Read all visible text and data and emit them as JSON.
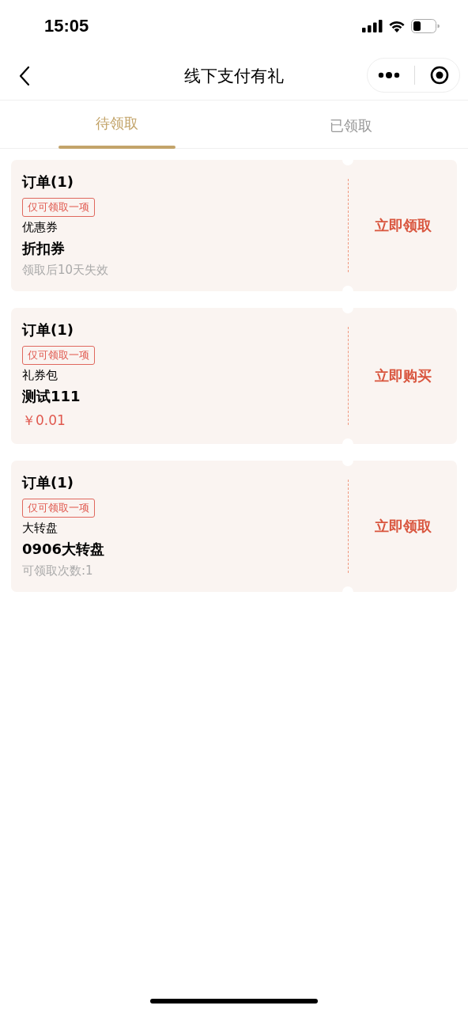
{
  "status_bar": {
    "time": "15:05"
  },
  "nav": {
    "title": "线下支付有礼"
  },
  "tabs": [
    {
      "label": "待领取",
      "selected": true
    },
    {
      "label": "已领取",
      "selected": false
    }
  ],
  "cards": [
    {
      "title": "订单(1)",
      "tag": "仅可领取一项",
      "category": "优惠券",
      "name": "折扣券",
      "footer": "领取后10天失效",
      "kind": "note",
      "action": "立即领取"
    },
    {
      "title": "订单(1)",
      "tag": "仅可领取一项",
      "category": "礼券包",
      "name": "测试111",
      "footer": "￥0.01",
      "kind": "price",
      "action": "立即购买"
    },
    {
      "title": "订单(1)",
      "tag": "仅可领取一项",
      "category": "大转盘",
      "name": "0906大转盘",
      "footer": "可领取次数:1",
      "kind": "note",
      "action": "立即领取"
    }
  ]
}
